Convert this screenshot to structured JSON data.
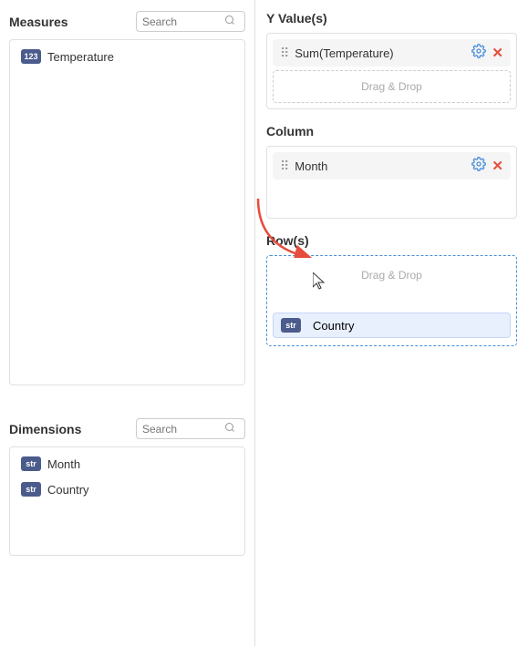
{
  "leftPanel": {
    "measuresTitle": "Measures",
    "measuresSearchPlaceholder": "Search",
    "measureItems": [
      {
        "label": "Temperature",
        "badgeType": "123"
      }
    ],
    "dimensionsTitle": "Dimensions",
    "dimensionsSearchPlaceholder": "Search",
    "dimensionItems": [
      {
        "label": "Month",
        "badgeType": "str"
      },
      {
        "label": "Country",
        "badgeType": "str"
      }
    ]
  },
  "rightPanel": {
    "yValuesTitle": "Y Value(s)",
    "yFields": [
      {
        "label": "Sum(Temperature)"
      }
    ],
    "yDragDrop": "Drag & Drop",
    "columnTitle": "Column",
    "columnFields": [
      {
        "label": "Month"
      }
    ],
    "rowsTitle": "Row(s)",
    "rowsDragDrop": "Drag & Drop",
    "rowsFields": [
      {
        "label": "Country",
        "badgeType": "str"
      }
    ]
  }
}
